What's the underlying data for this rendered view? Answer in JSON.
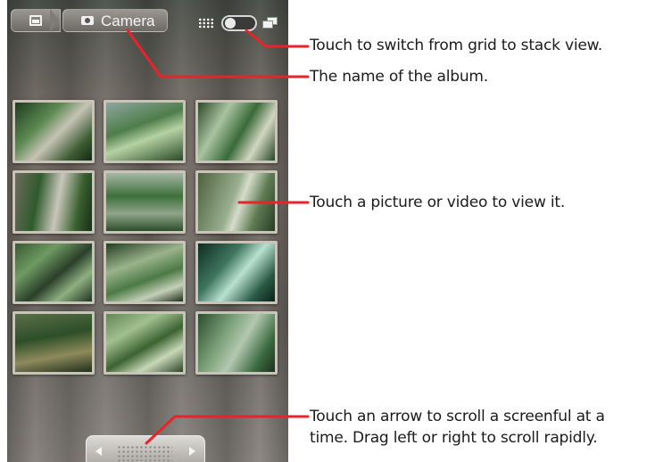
{
  "app": {
    "breadcrumb_album": "Camera"
  },
  "icons": {
    "home": "picture-icon",
    "album": "camera-icon",
    "grid": "grid-icon",
    "toggle": "grid-stack-toggle",
    "stack": "stack-icon",
    "scroll_left": "left-arrow-icon",
    "scroll_right": "right-arrow-icon"
  },
  "thumbnails": [
    {
      "label": "photo 1"
    },
    {
      "label": "photo 2"
    },
    {
      "label": "photo 3"
    },
    {
      "label": "photo 4"
    },
    {
      "label": "photo 5"
    },
    {
      "label": "photo 6"
    },
    {
      "label": "photo 7"
    },
    {
      "label": "photo 8"
    },
    {
      "label": "photo 9"
    },
    {
      "label": "photo 10"
    },
    {
      "label": "photo 11"
    },
    {
      "label": "photo 12"
    }
  ],
  "annotations": {
    "switch_view": "Touch to switch from grid to stack view.",
    "album_name": "The name of the album.",
    "view_item": "Touch a picture or video to view it.",
    "scroll_line1": "Touch an arrow to scroll a screenful at a",
    "scroll_line2": "time. Drag left or right to scroll rapidly."
  },
  "colors": {
    "callout": "#e8232a",
    "annotation_text": "#1b1b1b",
    "thumbnail_border": "#c9c4b8"
  }
}
